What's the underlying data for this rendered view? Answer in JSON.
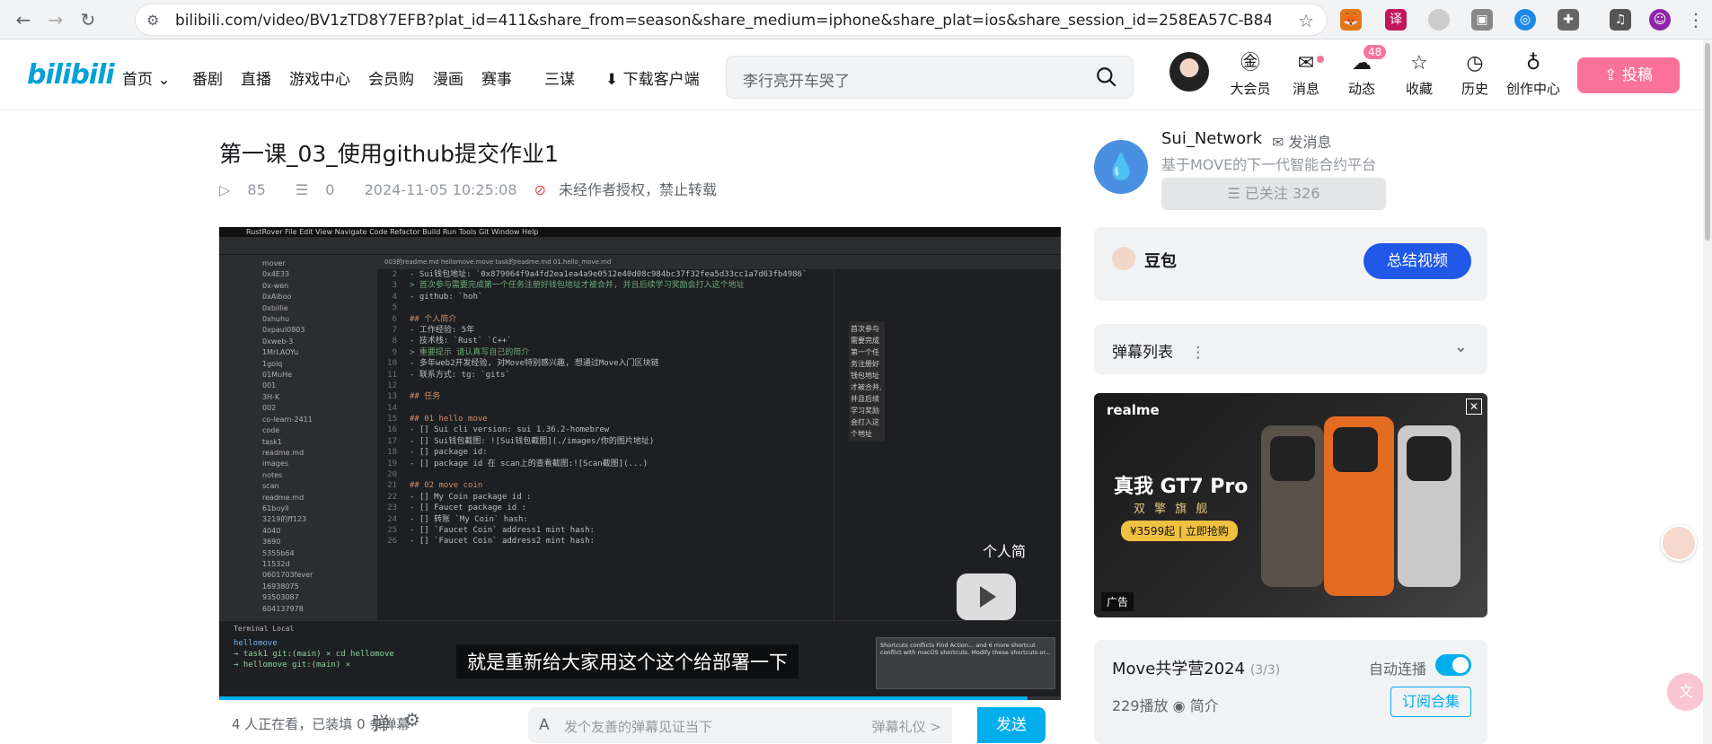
{
  "browser": {
    "url": "bilibili.com/video/BV1zTD8Y7EFB?plat_id=411&share_from=season&share_medium=iphone&share_plat=ios&share_session_id=258EA57C-B843...",
    "back_icon": "arrow-left-icon",
    "forward_icon": "arrow-right-icon",
    "reload_icon": "reload-icon"
  },
  "header": {
    "logo": "bilibili",
    "nav": [
      "首页",
      "番剧",
      "直播",
      "游戏中心",
      "会员购",
      "漫画",
      "赛事",
      "三谋",
      "下载客户端"
    ],
    "search_placeholder": "李行亮开车哭了",
    "items": [
      {
        "label": "大会员",
        "icon": "vip-icon"
      },
      {
        "label": "消息",
        "icon": "mail-icon"
      },
      {
        "label": "动态",
        "icon": "wind-icon",
        "badge": "48"
      },
      {
        "label": "收藏",
        "icon": "star-icon"
      },
      {
        "label": "历史",
        "icon": "clock-icon"
      },
      {
        "label": "创作中心",
        "icon": "bulb-icon"
      }
    ],
    "upload": "投稿",
    "accent": "#fb7299"
  },
  "video": {
    "title": "第一课_03_使用github提交作业1",
    "plays": "85",
    "danmaku": "0",
    "date": "2024-11-05 10:25:08",
    "copyright": "未经作者授权，禁止转载",
    "subtitle": "就是重新给大家用这个这个给部署一下",
    "preview_heading": "个人简",
    "watching": "4 人正在看，已装填 0 条弹幕",
    "dm_placeholder": "发个友善的弹幕见证当下",
    "dm_etiquette": "弹幕礼仪 >",
    "send": "发送"
  },
  "ide": {
    "menubar": "RustRover  File  Edit  View  Navigate  Code  Refactor  Build  Run  Tools  Git  Window  Help",
    "tabs": "003的readme.md    hellomove.move    task的readme.md    01.hello_move.md",
    "tree": [
      "mover",
      "0x4E33",
      "0x-wen",
      "0xAiboo",
      "0xbillie",
      "0xhuhu",
      "0xpaul0803",
      "0xweb-3",
      "1MrLAOYu",
      "1goiq",
      "01MuHe",
      "001",
      "3H-K",
      "002",
      "co-learn-2411",
      "code",
      "task1",
      "readme.md",
      "images",
      "notes",
      "scan",
      "readme.md",
      "61buyll",
      "3219的ff123",
      "4040",
      "3690",
      "5355b64",
      "11532d",
      "0601703fever",
      "16938075",
      "93503087",
      "604137978"
    ],
    "code": [
      {
        "n": "2",
        "t": "- Sui钱包地址: `0x879064f9a4fd2ea1ea4a9e0512e40d08c984bc37f32fea5d33cc1a7d63fb4986`"
      },
      {
        "n": "3",
        "t": "> 首次参与需要完成第一个任务注册好钱包地址才被合并, 并且后续学习奖励会打入这个地址"
      },
      {
        "n": "4",
        "t": "- github: `hoh`"
      },
      {
        "n": "5",
        "t": ""
      },
      {
        "n": "6",
        "t": "## 个人简介"
      },
      {
        "n": "7",
        "t": "- 工作经验: 5年"
      },
      {
        "n": "8",
        "t": "- 技术栈: `Rust` `C++`"
      },
      {
        "n": "9",
        "t": "> 重要提示 请认真写自己的简介"
      },
      {
        "n": "10",
        "t": "- 多年web2开发经验, 对Move特别感兴趣, 想通过Move入门区块链"
      },
      {
        "n": "11",
        "t": "- 联系方式: tg: `gits`"
      },
      {
        "n": "12",
        "t": ""
      },
      {
        "n": "13",
        "t": "## 任务"
      },
      {
        "n": "14",
        "t": ""
      },
      {
        "n": "15",
        "t": "## 01 hello move"
      },
      {
        "n": "16",
        "t": "- [] Sui cli version: sui 1.36.2-homebrew"
      },
      {
        "n": "17",
        "t": "- [] Sui钱包截图: ![Sui钱包截图](./images/你的图片地址)"
      },
      {
        "n": "18",
        "t": "- [] package id:"
      },
      {
        "n": "19",
        "t": "- [] package id 在 scan上的查看截图:![Scan截图](...)"
      },
      {
        "n": "20",
        "t": ""
      },
      {
        "n": "21",
        "t": "## 02 move coin"
      },
      {
        "n": "22",
        "t": "- [] My Coin package id :"
      },
      {
        "n": "23",
        "t": "- [] Faucet package id :"
      },
      {
        "n": "24",
        "t": "- [] 转账 `My Coin` hash:"
      },
      {
        "n": "25",
        "t": "- [] `Faucet Coin` address1 mint hash:"
      },
      {
        "n": "26",
        "t": "- [] `Faucet Coin` address2 mint hash:"
      }
    ],
    "preview_lines": [
      "首次参与需要完成第一个任务注册好钱包地址才被合并, 并且后续学习奖励会打入这个地址"
    ],
    "terminal": [
      "hellomove",
      "→ task1 git:(main) × cd hellomove",
      "→ hellomove git:(main) ×"
    ],
    "popup": "Shortcuts conflicts  Find Action... and 6 more shortcut conflict with macOS shortcuts. Modify these shortcuts or..."
  },
  "uploader": {
    "name": "Sui_Network",
    "msg": "发消息",
    "desc": "基于MOVE的下一代智能合约平台",
    "follow": "☰ 已关注 326"
  },
  "doubao": {
    "name": "豆包",
    "btn": "总结视频"
  },
  "danmaku_list": {
    "label": "弹幕列表"
  },
  "ad": {
    "brand": "realme",
    "title": "真我 GT7 Pro",
    "subtitle": "双 擎 旗 舰",
    "price": "¥3599起 | 立即抢购",
    "tag": "广告"
  },
  "collection": {
    "title": "Move共学营2024",
    "count": "(3/3)",
    "autoplay": "自动连播",
    "plays": "229播放",
    "intro": "简介",
    "subscribe": "订阅合集"
  }
}
